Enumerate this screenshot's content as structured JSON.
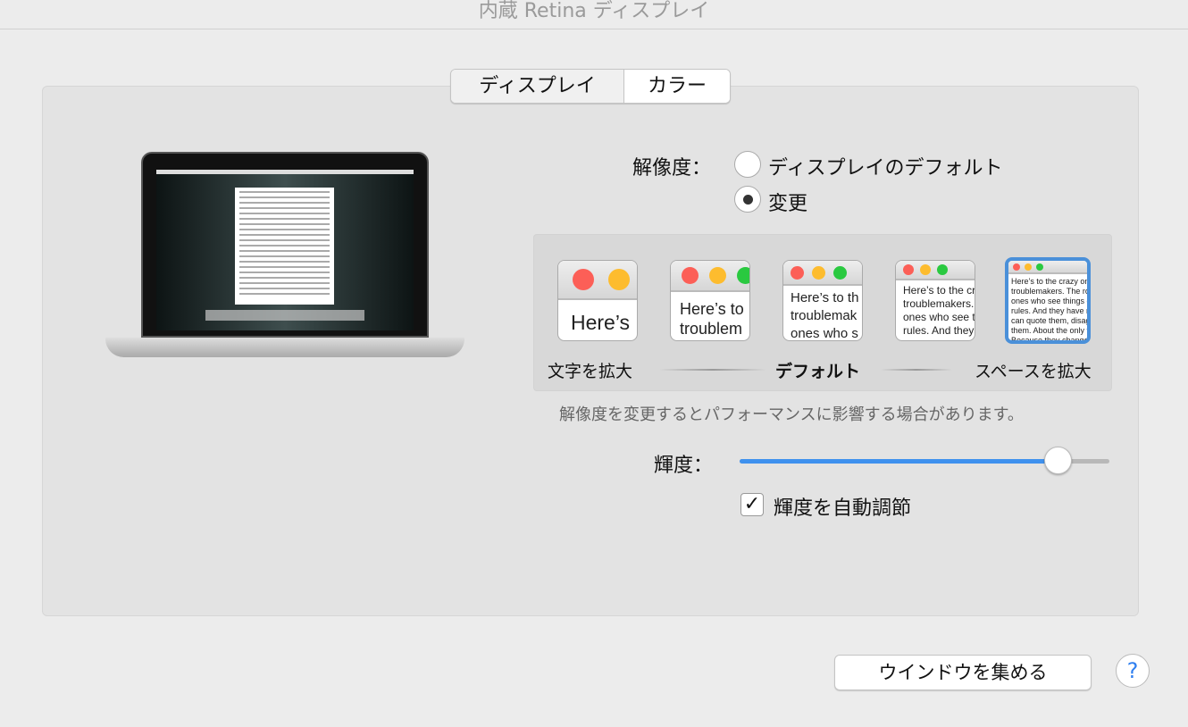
{
  "window": {
    "title": "内蔵 Retina ディスプレイ"
  },
  "tabs": [
    {
      "label": "ディスプレイ",
      "selected": true
    },
    {
      "label": "カラー",
      "selected": false
    }
  ],
  "resolution": {
    "label": "解像度：",
    "options": [
      {
        "label": "ディスプレイのデフォルト",
        "selected": false
      },
      {
        "label": "変更",
        "selected": true
      }
    ],
    "thumbnails": [
      {
        "text": "Here’s"
      },
      {
        "text": "Here’s to troublem"
      },
      {
        "text": "Here’s to th troublemak ones who s"
      },
      {
        "text": "Here’s to the cr troublemakers. ones who see t rules. And they"
      },
      {
        "text": "Here’s to the crazy one troublemakers. The rou ones who see things dif rules. And they have no can quote them, disagre them. About the only th Because they change t",
        "selected": true
      }
    ],
    "scale_left": "文字を拡大",
    "scale_center": "デフォルト",
    "scale_right": "スペースを拡大",
    "note": "解像度を変更するとパフォーマンスに影響する場合があります。"
  },
  "brightness": {
    "label": "輝度：",
    "value": 0.86,
    "auto_label": "輝度を自動調節",
    "auto_checked": true,
    "check_glyph": "✓"
  },
  "buttons": {
    "gather_windows": "ウインドウを集める",
    "help": "?"
  },
  "colors": {
    "accent": "#3f91ee",
    "red": "#fc5f57",
    "yellow": "#fdbc2e",
    "green": "#2ac940"
  }
}
